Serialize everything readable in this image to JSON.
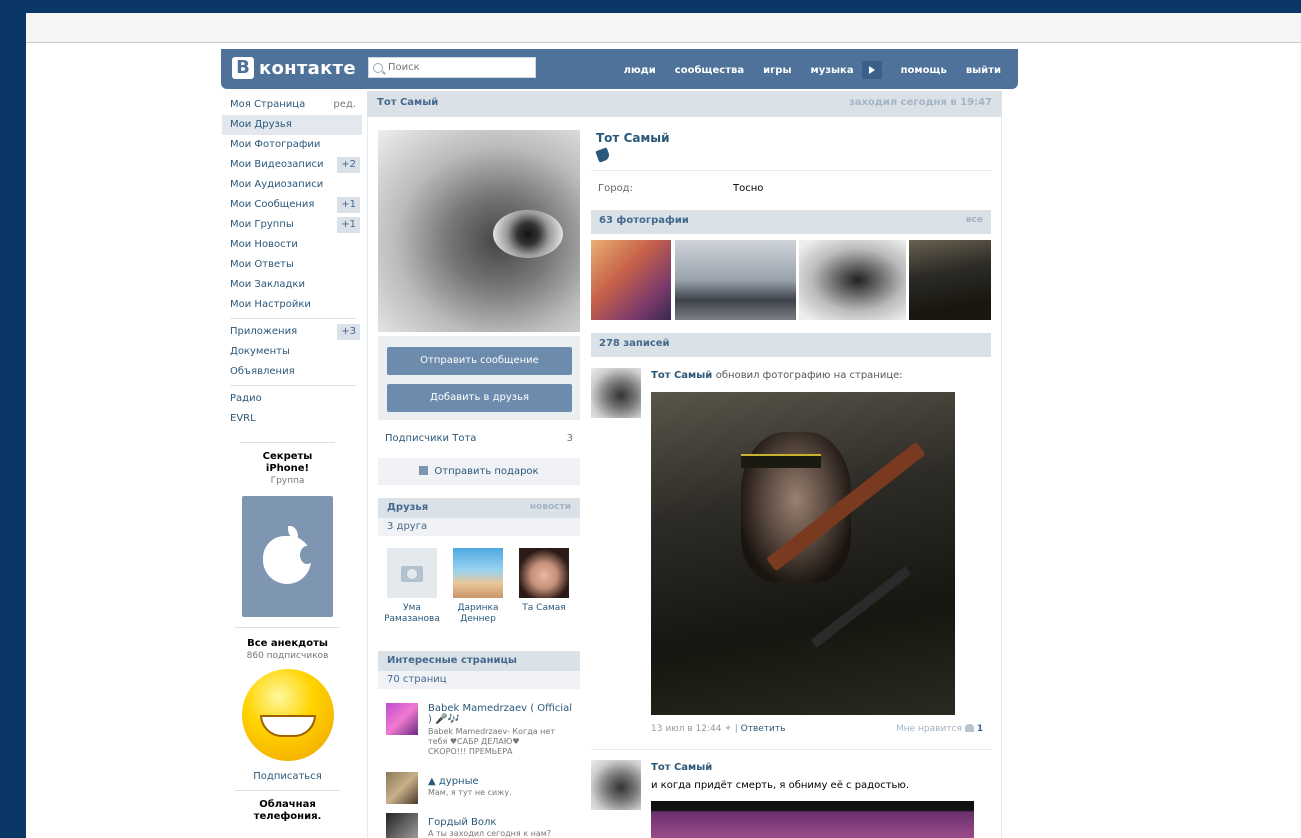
{
  "header": {
    "logo_letter": "В",
    "logo_text": "контакте",
    "search_placeholder": "Поиск",
    "nav": [
      "люди",
      "сообщества",
      "игры",
      "музыка",
      "помощь",
      "выйти"
    ]
  },
  "left_menu": {
    "items": [
      {
        "label": "Моя Страница",
        "extra": "ред."
      },
      {
        "label": "Мои Друзья",
        "active": true
      },
      {
        "label": "Мои Фотографии"
      },
      {
        "label": "Мои Видеозаписи",
        "badge": "+2"
      },
      {
        "label": "Мои Аудиозаписи"
      },
      {
        "label": "Мои Сообщения",
        "badge": "+1"
      },
      {
        "label": "Мои Группы",
        "badge": "+1"
      },
      {
        "label": "Мои Новости"
      },
      {
        "label": "Мои Ответы"
      },
      {
        "label": "Мои Закладки"
      },
      {
        "label": "Мои Настройки"
      }
    ],
    "items2": [
      {
        "label": "Приложения",
        "badge": "+3"
      },
      {
        "label": "Документы"
      },
      {
        "label": "Объявления"
      }
    ],
    "items3": [
      {
        "label": "Радио"
      },
      {
        "label": "EVRL"
      }
    ]
  },
  "ads": [
    {
      "title": "Секреты iPhone!",
      "subtitle": "Группа"
    },
    {
      "title": "Все анекдоты",
      "subtitle": "860 подписчиков",
      "action": "Подписаться"
    },
    {
      "title": "Облачная телефония."
    }
  ],
  "page": {
    "header_name": "Тот Самый",
    "last_seen": "заходил сегодня в 19:47",
    "send_message": "Отправить сообщение",
    "add_friend": "Добавить в друзья",
    "subscribers_label": "Подписчики Тота",
    "subscribers_count": "3",
    "send_gift": "Отправить подарок",
    "friends": {
      "title": "Друзья",
      "more": "новости",
      "count": "3 друга",
      "list": [
        {
          "name": "Ума Рамазанова"
        },
        {
          "name": "Даринка Деннер"
        },
        {
          "name": "Та Самая"
        }
      ]
    },
    "interesting": {
      "title": "Интересные страницы",
      "count": "70 страниц",
      "list": [
        {
          "name": "Babek Mamedrzaev ( Official ) 🎤🎶",
          "desc": "Babek Mamedrzaev- Когда нет тебя ♥САБР ДЕЛАЮ♥ СКОРО!!! ПРЕМЬЕРА"
        },
        {
          "name": "▲ дурные",
          "desc": "Мам, я тут не сижу."
        },
        {
          "name": "Гордый Волк",
          "desc": "А ты заходил сегодня к нам?"
        }
      ]
    }
  },
  "profile": {
    "name": "Тот Самый",
    "city_label": "Город:",
    "city_value": "Тосно",
    "photos_title": "63 фотографии",
    "photos_more": "все",
    "wall_title": "278 записей"
  },
  "posts": [
    {
      "author": "Тот Самый",
      "action": "обновил фотографию на странице:",
      "date": "13 июл в 12:44",
      "reply": "Ответить",
      "like_label": "Мне нравится",
      "like_count": "1"
    },
    {
      "author": "Тот Самый",
      "text": "и когда придёт смерть, я обниму её с радостью."
    }
  ]
}
